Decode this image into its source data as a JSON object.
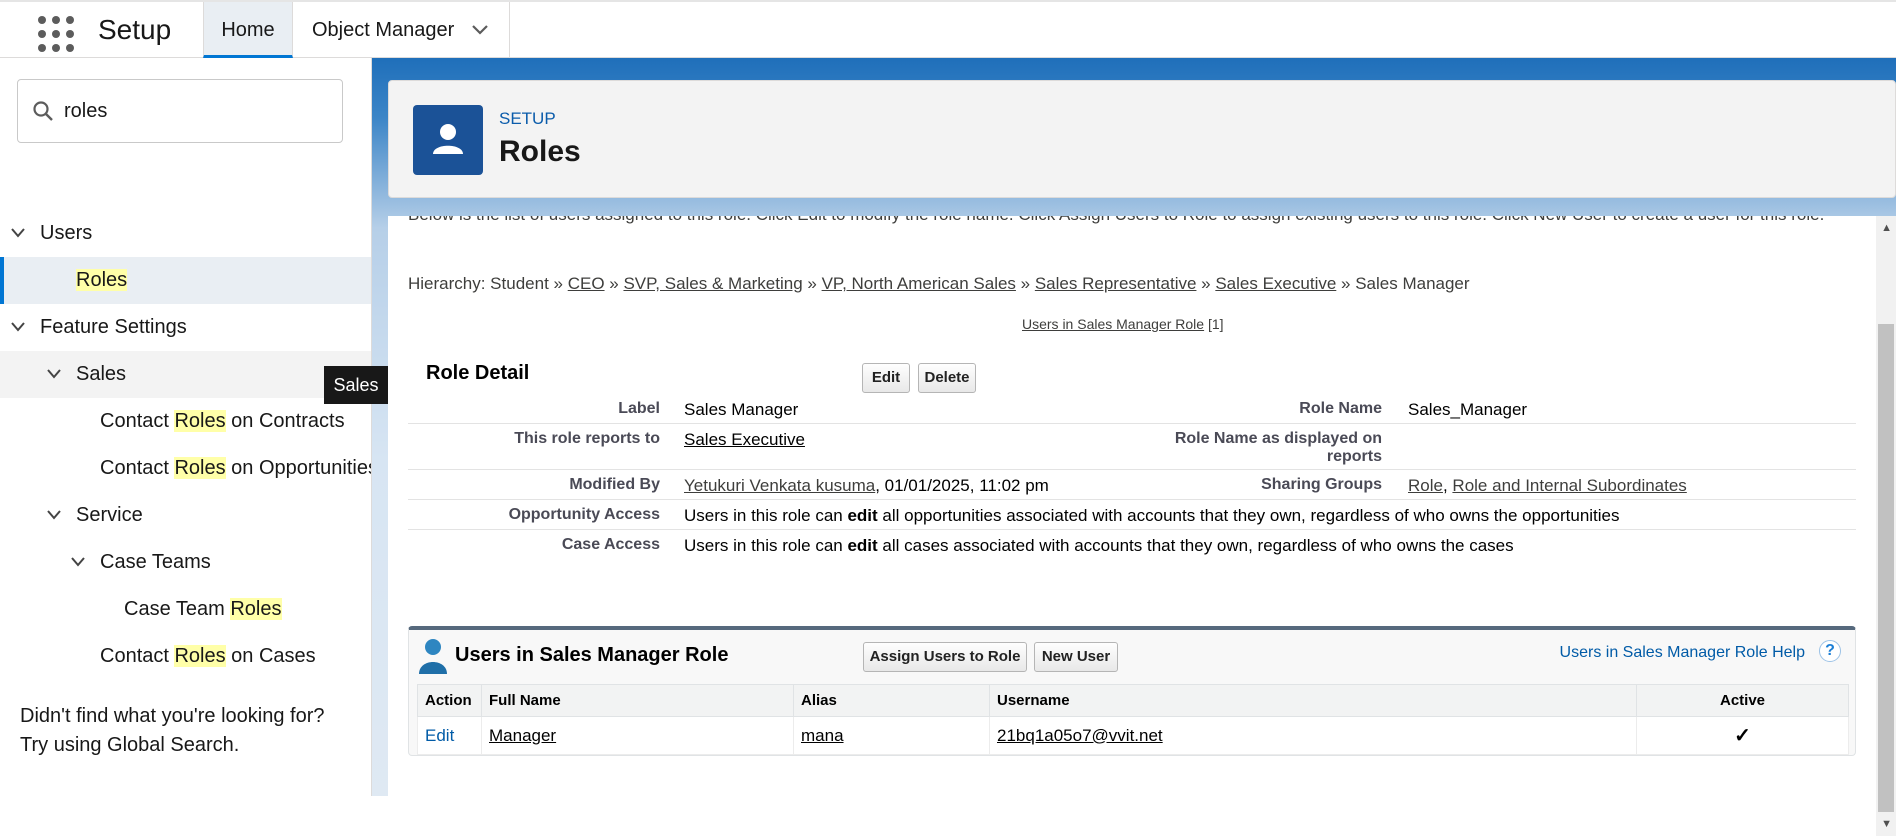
{
  "topbar": {
    "app_name": "Setup",
    "tabs": [
      {
        "label": "Home"
      },
      {
        "label": "Object Manager"
      }
    ]
  },
  "sidebar": {
    "search_value": "roles",
    "items": [
      {
        "label": "Users"
      },
      {
        "label": "Roles"
      },
      {
        "label": "Feature Settings"
      },
      {
        "label": "Sales"
      },
      {
        "pre": "Contact ",
        "hl": "Roles",
        "post": " on Contracts"
      },
      {
        "pre": "Contact ",
        "hl": "Roles",
        "post": " on Opportunities"
      },
      {
        "label": "Service"
      },
      {
        "label": "Case Teams"
      },
      {
        "pre": "Case Team ",
        "hl": "Roles",
        "post": ""
      },
      {
        "pre": "Contact ",
        "hl": "Roles",
        "post": " on Cases"
      }
    ],
    "tooltip": "Sales",
    "not_found_line1": "Didn't find what you're looking for?",
    "not_found_line2": "Try using Global Search."
  },
  "header": {
    "eyebrow": "SETUP",
    "title": "Roles"
  },
  "content": {
    "intro": "Below is the list of users assigned to this role. Click Edit to modify the role name. Click Assign Users to Role to assign existing users to this role. Click New User to create a user for this role.",
    "hierarchy": {
      "prefix": "Hierarchy: Student » ",
      "links": [
        "CEO",
        "SVP, Sales & Marketing",
        "VP, North American Sales",
        "Sales Representative",
        "Sales Executive"
      ],
      "sep": " » ",
      "current": "Sales Manager"
    },
    "related_link": "Users in Sales Manager Role",
    "related_count": "[1]",
    "role_detail": {
      "title": "Role Detail",
      "edit_label": "Edit",
      "delete_label": "Delete",
      "label_label": "Label",
      "label_value": "Sales Manager",
      "role_name_label": "Role Name",
      "role_name_value": "Sales_Manager",
      "reports_to_label": "This role reports to",
      "reports_to_value": "Sales Executive",
      "display_label": "Role Name as displayed on reports",
      "modified_by_label": "Modified By",
      "modified_by_user": "Yetukuri Venkata kusuma",
      "modified_by_date": ", 01/01/2025, 11:02 pm",
      "sharing_label": "Sharing Groups",
      "sharing_role": "Role",
      "sharing_sep": ", ",
      "sharing_internal": "Role and Internal Subordinates",
      "opp_label": "Opportunity Access",
      "opp_pre": "Users in this role can ",
      "opp_bold": "edit",
      "opp_post": " all opportunities associated with accounts that they own, regardless of who owns the opportunities",
      "case_label": "Case Access",
      "case_pre": "Users in this role can ",
      "case_bold": "edit",
      "case_post": " all cases associated with accounts that they own, regardless of who owns the cases"
    },
    "users_section": {
      "title": "Users in Sales Manager Role",
      "assign_label": "Assign Users to Role",
      "new_user_label": "New User",
      "help_label": "Users in Sales Manager Role Help",
      "help_icon": "?",
      "columns": [
        "Action",
        "Full Name",
        "Alias",
        "Username",
        "Active"
      ],
      "rows": [
        {
          "action": "Edit",
          "full_name": "Manager",
          "alias": "mana",
          "username": "21bq1a05o7@vvit.net",
          "active": "✓"
        }
      ]
    }
  },
  "colors": {
    "brand": "#0176d3",
    "header_icon": "#1b5297",
    "highlight": "#ffffa8",
    "link": "#015ba7"
  }
}
